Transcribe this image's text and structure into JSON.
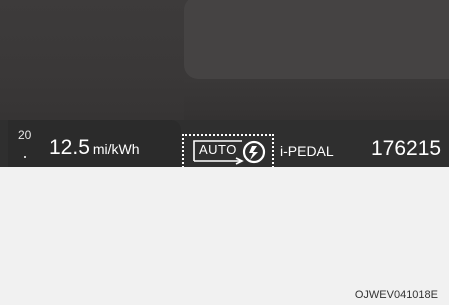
{
  "cluster": {
    "partial_value": "20",
    "efficiency": {
      "value": "12.5",
      "unit": "mi/kWh"
    },
    "regen_mode": {
      "label": "AUTO",
      "icon": "regen-auto-icon"
    },
    "ipedal_label": "i-PEDAL",
    "odometer": "176215"
  },
  "caption": {
    "code": "OJWEV041018E"
  },
  "colors": {
    "screen_bg": "#3a3a3a",
    "status_bar_bg": "#2f2f2f",
    "text": "#ffffff",
    "lower_bg": "#f1f1f1"
  }
}
